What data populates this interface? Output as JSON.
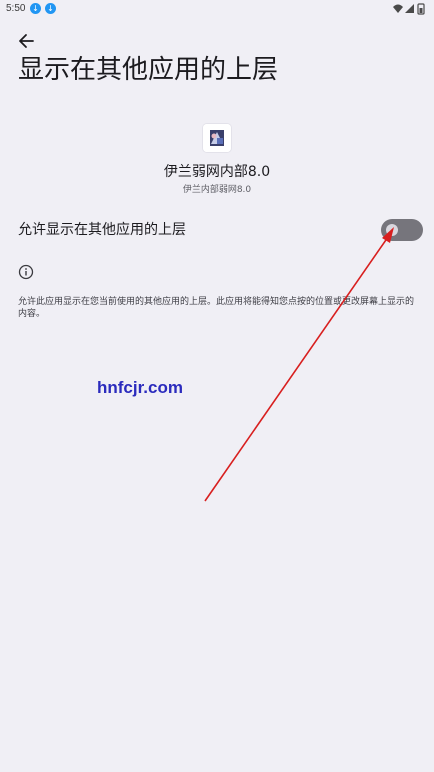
{
  "status_bar": {
    "time": "5:50",
    "icons": [
      "download-icon",
      "download-icon",
      "wifi-icon",
      "signal-icon",
      "battery-icon"
    ]
  },
  "header": {
    "back_icon": "arrow-back-icon",
    "title": "显示在其他应用的上层"
  },
  "app": {
    "icon": "app-icon",
    "name": "伊兰弱网内部8.0",
    "package": "伊兰内部弱网8.0"
  },
  "setting": {
    "label": "允许显示在其他应用的上层",
    "enabled": false
  },
  "info": {
    "icon": "info-icon",
    "description": "允许此应用显示在您当前使用的其他应用的上层。此应用将能得知您点按的位置或更改屏幕上显示的内容。"
  },
  "watermark": "hnfcjr.com",
  "colors": {
    "background": "#f0eff5",
    "toggle_track": "#76757c",
    "annotation_arrow": "#d81f1f",
    "watermark": "#2b2bbd",
    "status_download": "#2196f3"
  }
}
